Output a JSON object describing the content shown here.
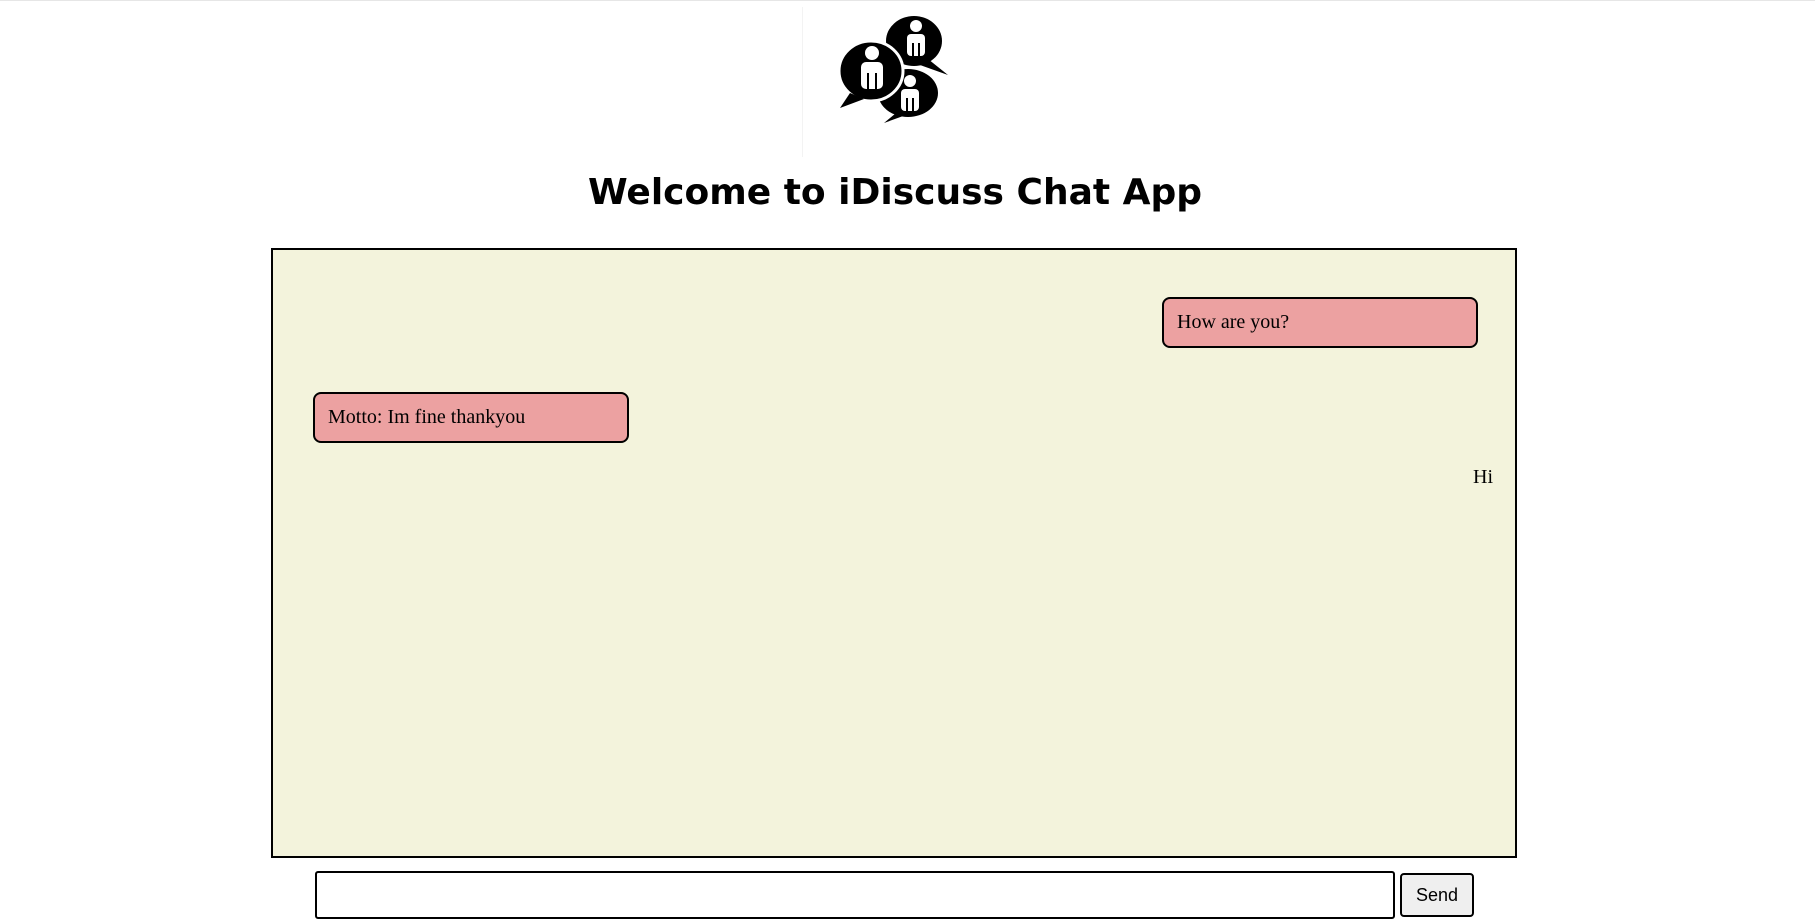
{
  "header": {
    "logo_icon": "chat-people-bubbles-icon",
    "title": "Welcome to iDiscuss Chat App"
  },
  "chat": {
    "background": "#f3f3dc",
    "bubble_color": "#eca1a1",
    "messages": [
      {
        "side": "right",
        "text": "How are you?"
      },
      {
        "side": "left",
        "text": "Motto: Im fine thankyou"
      },
      {
        "side": "right",
        "text": "Hi"
      }
    ]
  },
  "composer": {
    "input_value": "",
    "placeholder": "",
    "send_label": "Send"
  }
}
